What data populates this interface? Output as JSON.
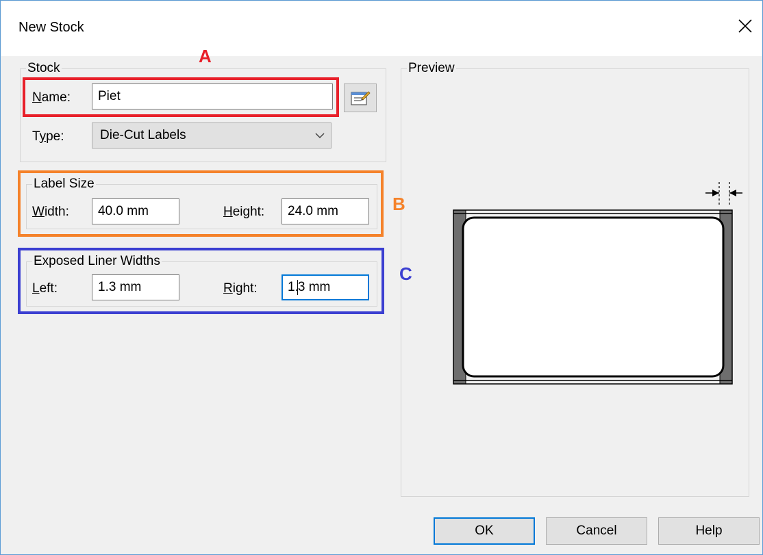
{
  "window": {
    "title": "New Stock"
  },
  "stock": {
    "legend": "Stock",
    "name_label_u": "N",
    "name_label_rest": "ame:",
    "name_value": "Piet",
    "type_label_pre": "T",
    "type_label_u": "y",
    "type_label_rest": "pe:",
    "type_value": "Die-Cut Labels"
  },
  "label_size": {
    "legend": "Label Size",
    "width_label_u": "W",
    "width_label_rest": "idth:",
    "width_value": "40.0 mm",
    "height_label_u": "H",
    "height_label_rest": "eight:",
    "height_value": "24.0 mm"
  },
  "liner": {
    "legend": "Exposed Liner Widths",
    "left_label_u": "L",
    "left_label_rest": "eft:",
    "left_value": "1.3 mm",
    "right_label_u": "R",
    "right_label_rest": "ight:",
    "right_value_before_caret": "1.",
    "right_value_after_caret": "3 mm"
  },
  "preview": {
    "legend": "Preview"
  },
  "annotations": {
    "a": "A",
    "b": "B",
    "c": "C",
    "colors": {
      "a": "#e8202a",
      "b": "#f5822a",
      "c": "#3b3fd1"
    }
  },
  "buttons": {
    "ok": "OK",
    "cancel": "Cancel",
    "help": "Help"
  },
  "icons": {
    "close": "close-icon",
    "properties": "properties-icon",
    "dropdown": "chevron-down-icon"
  }
}
